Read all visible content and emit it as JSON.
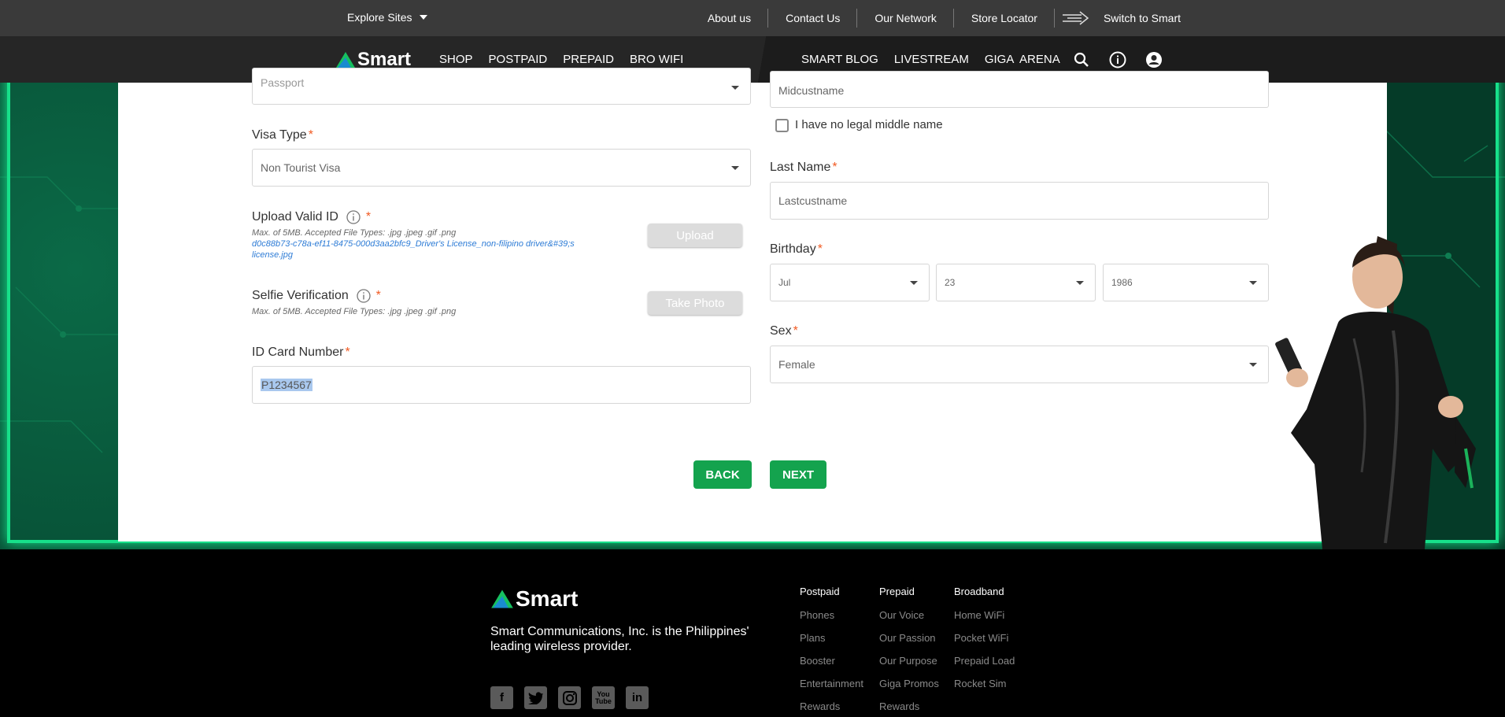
{
  "topbar": {
    "explore_label": "Explore Sites",
    "links": [
      "About us",
      "Contact Us",
      "Our Network",
      "Store Locator"
    ],
    "switch_label": "Switch to Smart"
  },
  "brand": {
    "name": "Smart"
  },
  "nav": {
    "left": [
      "SHOP",
      "POSTPAID",
      "PREPAID",
      "BRO WIFI"
    ],
    "right": [
      "SMART BLOG",
      "LIVESTREAM",
      "GIGA  ARENA"
    ]
  },
  "form": {
    "id_type_value": "Passport",
    "visa_label": "Visa Type",
    "visa_value": "Non Tourist Visa",
    "upload_label": "Upload Valid ID",
    "upload_hint": "Max. of 5MB. Accepted File Types: .jpg .jpeg .gif .png",
    "upload_filename": "d0c88b73-c78a-ef11-8475-000d3aa2bfc9_Driver's License_non-filipino driver&#39;s license.jpg",
    "upload_button": "Upload",
    "selfie_label": "Selfie Verification",
    "selfie_hint": "Max. of 5MB. Accepted File Types: .jpg .jpeg .gif .png",
    "selfie_button": "Take Photo",
    "id_number_label": "ID Card Number",
    "id_number_value": "P1234567",
    "middle_name_value": "Midcustname",
    "no_middle_label": "I have no legal middle name",
    "last_name_label": "Last Name",
    "last_name_value": "Lastcustname",
    "birthday_label": "Birthday",
    "birth_month": "Jul",
    "birth_day": "23",
    "birth_year": "1986",
    "sex_label": "Sex",
    "sex_value": "Female",
    "required_mark": "*",
    "back_button": "BACK",
    "next_button": "NEXT"
  },
  "footer": {
    "tagline": "Smart Communications, Inc. is the Philippines' leading wireless provider.",
    "postpaid": {
      "heading": "Postpaid",
      "items": [
        "Phones",
        "Plans",
        "Booster",
        "Entertainment",
        "Rewards"
      ]
    },
    "prepaid": {
      "heading": "Prepaid",
      "items": [
        "Our Voice",
        "Our Passion",
        "Our Purpose",
        "Giga Promos",
        "Rewards"
      ]
    },
    "broadband": {
      "heading": "Broadband",
      "items": [
        "Home WiFi",
        "Pocket WiFi",
        "Prepaid Load",
        "Rocket Sim"
      ]
    },
    "socials": [
      "facebook-icon",
      "twitter-icon",
      "instagram-icon",
      "youtube-icon",
      "linkedin-icon"
    ]
  },
  "colors": {
    "accent_green": "#14a34e",
    "required": "#f15a22",
    "frame_glow": "#17e08a",
    "link_blue": "#2e7cd6"
  }
}
